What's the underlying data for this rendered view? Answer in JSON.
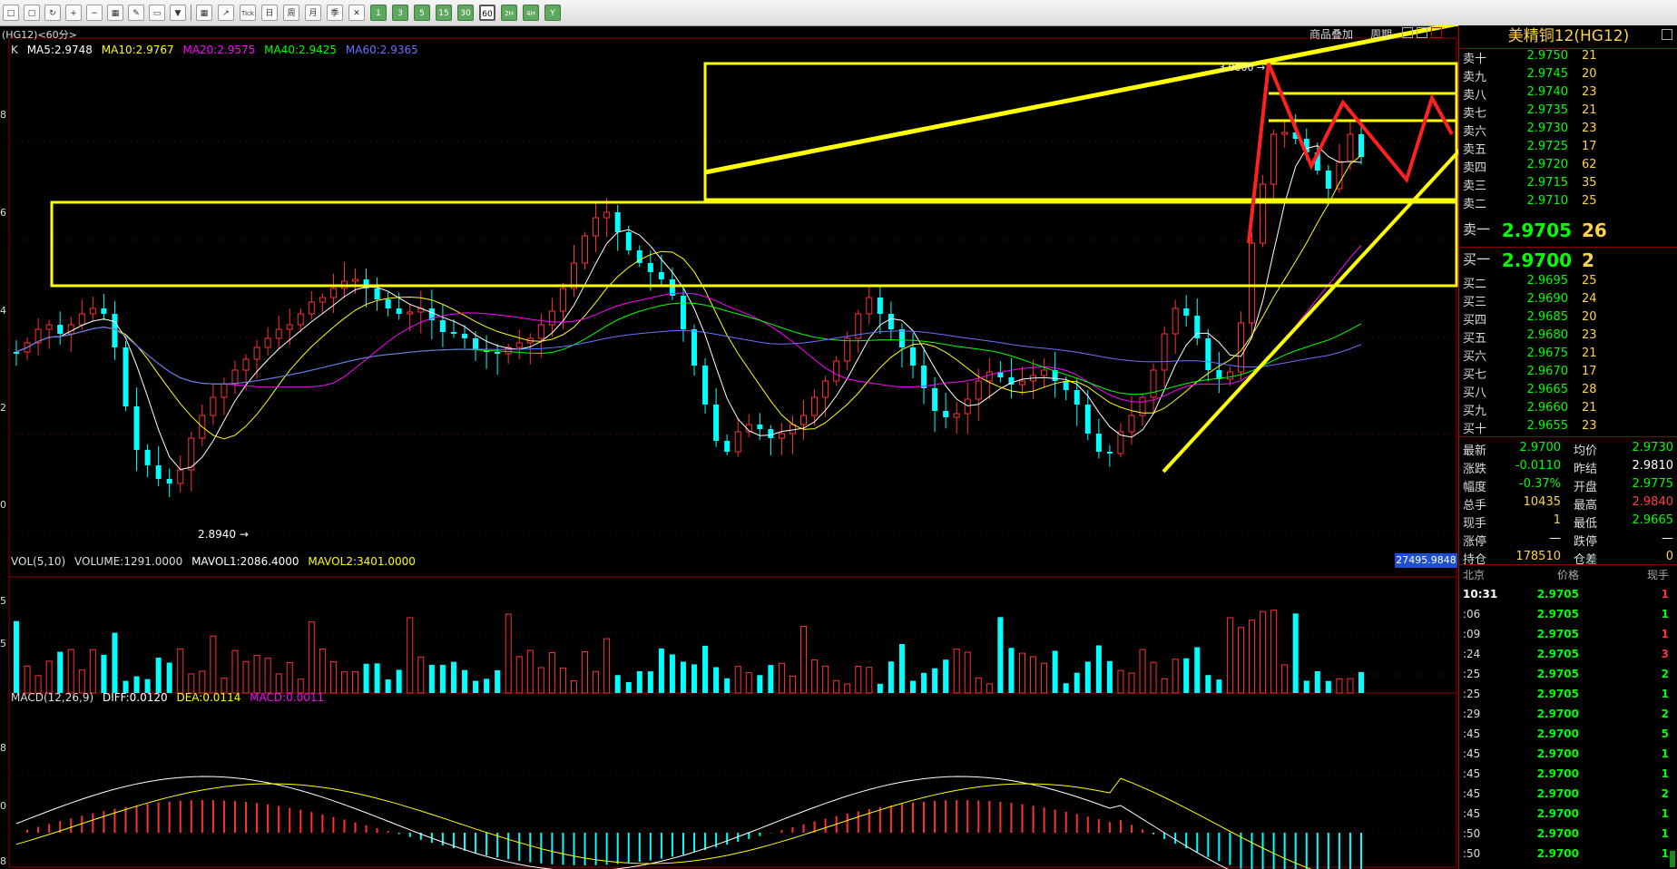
{
  "toolbar": {
    "icons": [
      "folder-icon",
      "book-icon",
      "refresh-icon",
      "zoom-in-icon",
      "zoom-out-icon",
      "window-icon",
      "pen-icon",
      "eraser-icon",
      "funnel-icon",
      "table-icon",
      "chart-icon",
      "tick-icon",
      "day-icon",
      "week-icon",
      "month-icon",
      "season-icon",
      "cross-icon"
    ],
    "tick_label": "Tick",
    "day": "日",
    "week": "周",
    "month": "月",
    "season": "季",
    "periods": [
      "1",
      "3",
      "5",
      "15",
      "30",
      "60",
      "2H",
      "4H",
      "Y"
    ],
    "selected_period": "60"
  },
  "chart_tab": "(HG12)<60分>",
  "controls": {
    "overlay": "商品叠加",
    "cycle": "周期"
  },
  "main_legend": {
    "k": "K",
    "ma5": "MA5:2.9748",
    "ma10": "MA10:2.9767",
    "ma20": "MA20:2.9575",
    "ma40": "MA40:2.9425",
    "ma60": "MA60:2.9365"
  },
  "axis_labels": {
    "a1": "8",
    "a2": "6",
    "a3": "4",
    "a4": "2",
    "a5": "0",
    "v1": "5",
    "v2": "5",
    "m1": "8",
    "m2": "0",
    "m3": "8"
  },
  "annotations": {
    "low_price": "2.8940",
    "high_price": "3.0000"
  },
  "vol_legend": {
    "vol": "VOL(5,10)",
    "volume": "VOLUME:1291.0000",
    "mavol1": "MAVOL1:2086.4000",
    "mavol2": "MAVOL2:3401.0000"
  },
  "vol_box": "27495.9848",
  "macd_legend": {
    "macd": "MACD(12,26,9)",
    "diff": "DIFF:0.0120",
    "dea": "DEA:0.0114",
    "val": "MACD:0.0011"
  },
  "quote": {
    "title": "美精铜12(HG12)",
    "asks": [
      {
        "label": "卖十",
        "price": "2.9750",
        "vol": "21"
      },
      {
        "label": "卖九",
        "price": "2.9745",
        "vol": "20"
      },
      {
        "label": "卖八",
        "price": "2.9740",
        "vol": "23"
      },
      {
        "label": "卖七",
        "price": "2.9735",
        "vol": "21"
      },
      {
        "label": "卖六",
        "price": "2.9730",
        "vol": "23"
      },
      {
        "label": "卖五",
        "price": "2.9725",
        "vol": "17"
      },
      {
        "label": "卖四",
        "price": "2.9720",
        "vol": "62"
      },
      {
        "label": "卖三",
        "price": "2.9715",
        "vol": "35"
      },
      {
        "label": "卖二",
        "price": "2.9710",
        "vol": "25"
      },
      {
        "label": "卖一",
        "price": "2.9705",
        "vol": "26"
      }
    ],
    "bids": [
      {
        "label": "买一",
        "price": "2.9700",
        "vol": "2"
      },
      {
        "label": "买二",
        "price": "2.9695",
        "vol": "25"
      },
      {
        "label": "买三",
        "price": "2.9690",
        "vol": "24"
      },
      {
        "label": "买四",
        "price": "2.9685",
        "vol": "20"
      },
      {
        "label": "买五",
        "price": "2.9680",
        "vol": "23"
      },
      {
        "label": "买六",
        "price": "2.9675",
        "vol": "21"
      },
      {
        "label": "买七",
        "price": "2.9670",
        "vol": "17"
      },
      {
        "label": "买八",
        "price": "2.9665",
        "vol": "28"
      },
      {
        "label": "买九",
        "price": "2.9660",
        "vol": "21"
      },
      {
        "label": "买十",
        "price": "2.9655",
        "vol": "23"
      }
    ],
    "stats": [
      {
        "k1": "最新",
        "v1": "2.9700",
        "c1": "#00ff00",
        "k2": "均价",
        "v2": "2.9730",
        "c2": "#00ff00"
      },
      {
        "k1": "涨跌",
        "v1": "-0.0110",
        "c1": "#00ff00",
        "k2": "昨结",
        "v2": "2.9810",
        "c2": "#ffffff"
      },
      {
        "k1": "幅度",
        "v1": "-0.37%",
        "c1": "#00ff00",
        "k2": "开盘",
        "v2": "2.9775",
        "c2": "#00ff00"
      },
      {
        "k1": "总手",
        "v1": "10435",
        "c1": "#ffd24a",
        "k2": "最高",
        "v2": "2.9840",
        "c2": "#ff4040"
      },
      {
        "k1": "现手",
        "v1": "1",
        "c1": "#ffd24a",
        "k2": "最低",
        "v2": "2.9665",
        "c2": "#00ff00"
      },
      {
        "k1": "涨停",
        "v1": "—",
        "c1": "#ffffff",
        "k2": "跌停",
        "v2": "—",
        "c2": "#ffffff"
      },
      {
        "k1": "持仓",
        "v1": "178510",
        "c1": "#ffd24a",
        "k2": "仓差",
        "v2": "0",
        "c2": "#ffd24a"
      }
    ],
    "ticks_header": {
      "loc": "北京",
      "price": "价格",
      "vol": "现手"
    },
    "ticks": [
      {
        "t": "10:31",
        "p": "2.9705",
        "v": "1",
        "c": "#ff3030"
      },
      {
        "t": ":06",
        "p": "2.9705",
        "v": "1",
        "c": "#00ff00"
      },
      {
        "t": ":09",
        "p": "2.9705",
        "v": "1",
        "c": "#ff3030"
      },
      {
        "t": ":24",
        "p": "2.9705",
        "v": "3",
        "c": "#ff3030"
      },
      {
        "t": ":25",
        "p": "2.9705",
        "v": "2",
        "c": "#00ff00"
      },
      {
        "t": ":25",
        "p": "2.9705",
        "v": "1",
        "c": "#00ff00"
      },
      {
        "t": ":29",
        "p": "2.9700",
        "v": "2",
        "c": "#00ff00"
      },
      {
        "t": ":45",
        "p": "2.9700",
        "v": "5",
        "c": "#00ff00"
      },
      {
        "t": ":45",
        "p": "2.9700",
        "v": "1",
        "c": "#00ff00"
      },
      {
        "t": ":45",
        "p": "2.9700",
        "v": "1",
        "c": "#00ff00"
      },
      {
        "t": ":45",
        "p": "2.9700",
        "v": "2",
        "c": "#00ff00"
      },
      {
        "t": ":45",
        "p": "2.9700",
        "v": "1",
        "c": "#00ff00"
      },
      {
        "t": ":50",
        "p": "2.9700",
        "v": "1",
        "c": "#00ff00"
      },
      {
        "t": ":50",
        "p": "2.9700",
        "v": "1",
        "c": "#00ff00"
      }
    ]
  },
  "colors": {
    "up": "#ff3232",
    "down": "#00ffff",
    "ma5": "#ffffff",
    "ma10": "#ffff00",
    "ma20": "#ff00ff",
    "ma40": "#00ff00",
    "ma60": "#6f6fff",
    "annotation": "#ffff00",
    "arrow": "#ff2020"
  }
}
